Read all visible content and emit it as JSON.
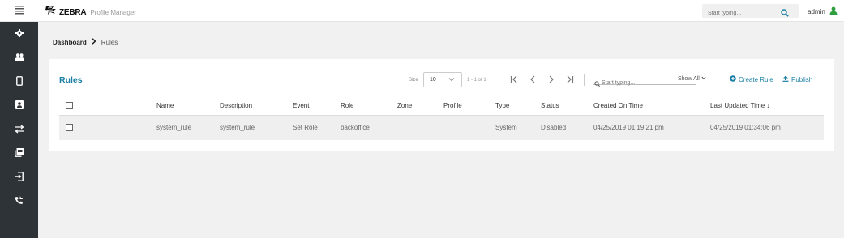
{
  "topbar": {
    "brand": "ZEBRA",
    "product": "Profile Manager",
    "search_placeholder": "Start typing...",
    "username": "admin",
    "user_color": "#2e9e3e"
  },
  "sidebar": {
    "items": [
      {
        "icon": "gear-icon"
      },
      {
        "icon": "users-icon"
      },
      {
        "icon": "device-icon"
      },
      {
        "icon": "profile-badge-icon"
      },
      {
        "icon": "rules-icon",
        "active": true
      },
      {
        "icon": "library-icon"
      },
      {
        "icon": "enroll-icon"
      },
      {
        "icon": "phone-icon"
      }
    ]
  },
  "breadcrumb": {
    "dashboard": "Dashboard",
    "separator": ">",
    "current": "Rules"
  },
  "card": {
    "title": "Rules",
    "size_label": "Size",
    "size_value": "10",
    "pager_info": "1 - 1 of 1",
    "filter_placeholder": "Start typing...",
    "show_all": "Show All",
    "create_rule": "Create Rule",
    "publish": "Publish",
    "accent": "#1a7fa5"
  },
  "table": {
    "columns": [
      "Name",
      "Description",
      "Event",
      "Role",
      "Zone",
      "Profile",
      "Type",
      "Status",
      "Created On Time",
      "Last Updated Time"
    ],
    "sort_indicator": "↓",
    "rows": [
      {
        "name": "system_rule",
        "description": "system_rule",
        "event": "Set Role",
        "role": "backoffice",
        "zone": "",
        "profile": "",
        "type": "System",
        "status": "Disabled",
        "created": "04/25/2019 01:19:21 pm",
        "updated": "04/25/2019 01:34:06 pm"
      }
    ]
  }
}
